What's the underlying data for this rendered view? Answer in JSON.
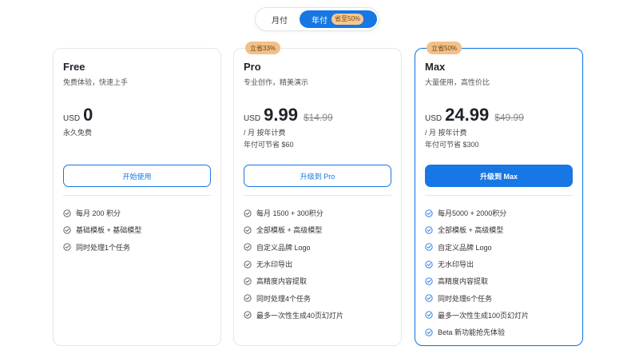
{
  "billing_toggle": {
    "monthly_label": "月付",
    "yearly_label": "年付",
    "yearly_badge": "省至50%",
    "active": "yearly"
  },
  "colors": {
    "accent": "#1677e5",
    "badge": "#f2c088",
    "check_gray": "#555555"
  },
  "plans": [
    {
      "name": "Free",
      "description": "免费体验，快速上手",
      "currency": "USD",
      "price": "0",
      "original_price": "",
      "subtitle_1": "永久免费",
      "subtitle_2": "",
      "badge": "",
      "cta_label": "开始使用",
      "features": [
        "每月 200 积分",
        "基础模板 + 基础模型",
        "同时处理1个任务"
      ]
    },
    {
      "name": "Pro",
      "description": "专业创作，精美演示",
      "currency": "USD",
      "price": "9.99",
      "original_price": "$14.99",
      "subtitle_1": "/ 月 按年计费",
      "subtitle_2": "年付可节省 $60",
      "badge": "立省33%",
      "cta_label": "升级到 Pro",
      "features": [
        "每月 1500 + 300积分",
        "全部模板 + 高级模型",
        "自定义品牌 Logo",
        "无水印导出",
        "高精度内容提取",
        "同时处理4个任务",
        "最多一次性生成40页幻灯片"
      ]
    },
    {
      "name": "Max",
      "description": "大量使用，高性价比",
      "currency": "USD",
      "price": "24.99",
      "original_price": "$49.99",
      "subtitle_1": "/ 月 按年计费",
      "subtitle_2": "年付可节省 $300",
      "badge": "立省50%",
      "cta_label": "升级到 Max",
      "features": [
        "每月5000 + 2000积分",
        "全部模板 + 高级模型",
        "自定义品牌 Logo",
        "无水印导出",
        "高精度内容提取",
        "同时处理6个任务",
        "最多一次性生成100页幻灯片",
        "Beta 新功能抢先体验"
      ]
    }
  ]
}
